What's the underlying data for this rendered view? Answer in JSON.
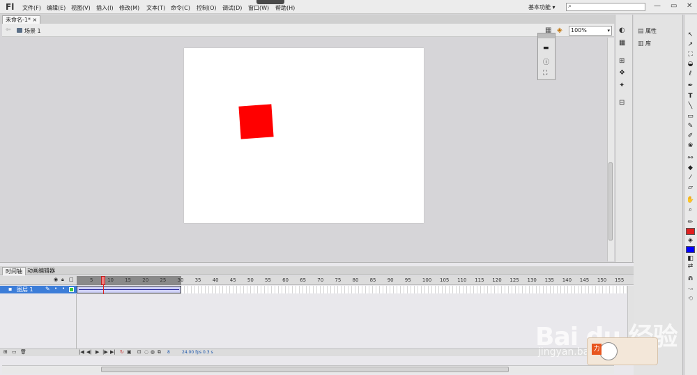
{
  "app": {
    "logo": "Fl",
    "menu": [
      "文件(F)",
      "编辑(E)",
      "视图(V)",
      "插入(I)",
      "修改(M)",
      "文本(T)",
      "命令(C)",
      "控制(O)",
      "调试(D)",
      "窗口(W)",
      "帮助(H)"
    ],
    "workspace": "基本功能",
    "workspace_caret": "▾",
    "search_icon": "⌕",
    "window_controls": [
      "—",
      "▭",
      "✕"
    ]
  },
  "document": {
    "tab_label": "未命名-1*",
    "tab_close": "×",
    "scene_label": "场景 1",
    "zoom": "100%",
    "zoom_caret": "▾"
  },
  "stage": {
    "background": "#ffffff",
    "shape_color": "#ff0000"
  },
  "right_panels": {
    "properties": "属性",
    "library": "库"
  },
  "timeline": {
    "tabs": [
      "时间轴",
      "动画编辑器"
    ],
    "layer_name": "图层 1",
    "ruler": [
      "5",
      "10",
      "15",
      "20",
      "25",
      "30",
      "35",
      "40",
      "45",
      "50",
      "55",
      "60",
      "65",
      "70",
      "75",
      "80",
      "85",
      "90",
      "95",
      "100",
      "105",
      "110",
      "115",
      "120",
      "125",
      "130",
      "135",
      "140",
      "145",
      "150",
      "155"
    ],
    "current_frame": "8",
    "fps": "24.00 fps",
    "time": "0.3 s",
    "playback_controls": [
      "|◀",
      "◀|",
      "▶",
      "|▶",
      "▶|"
    ]
  },
  "tools_colors": {
    "stroke": "#e02020",
    "fill": "#0000ff"
  },
  "watermark": {
    "main": "Bai du 经验",
    "sub": "jingyan.baidu.com",
    "tag": "力"
  }
}
